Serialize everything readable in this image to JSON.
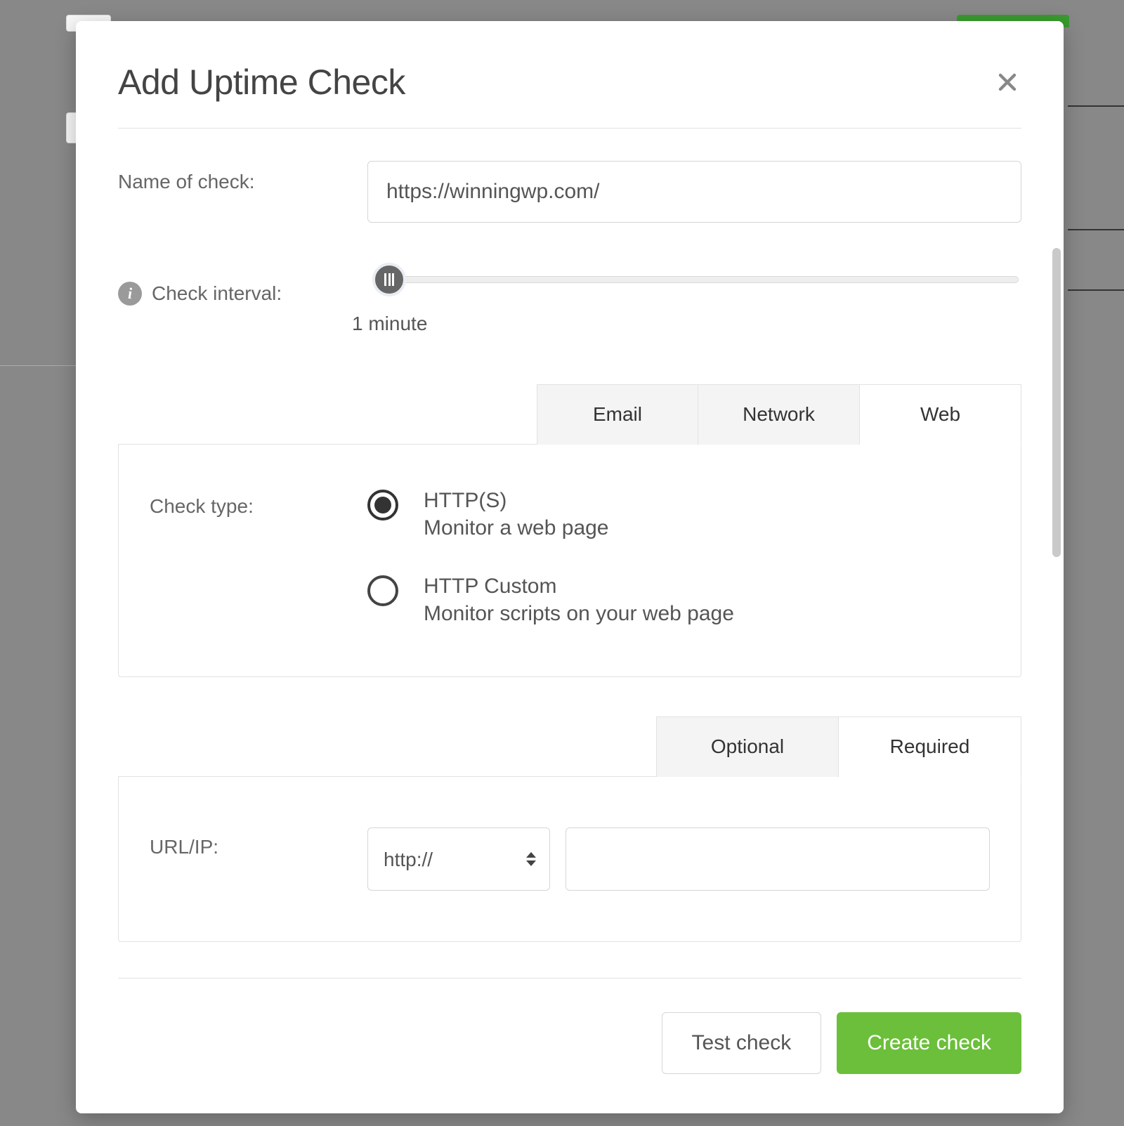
{
  "modal": {
    "title": "Add Uptime Check",
    "labels": {
      "name_of_check": "Name of check:",
      "check_interval": "Check interval:",
      "check_type": "Check type:",
      "url_ip": "URL/IP:"
    },
    "name_value": "https://winningwp.com/",
    "interval_caption": "1 minute",
    "tabs_category": {
      "email": "Email",
      "network": "Network",
      "web": "Web"
    },
    "check_types": {
      "https": {
        "title": "HTTP(S)",
        "sub": "Monitor a web page"
      },
      "custom": {
        "title": "HTTP Custom",
        "sub": "Monitor scripts on your web page"
      }
    },
    "tabs_fields": {
      "optional": "Optional",
      "required": "Required"
    },
    "protocol_selected": "http://",
    "url_value": "",
    "footer": {
      "test": "Test check",
      "create": "Create check"
    }
  }
}
